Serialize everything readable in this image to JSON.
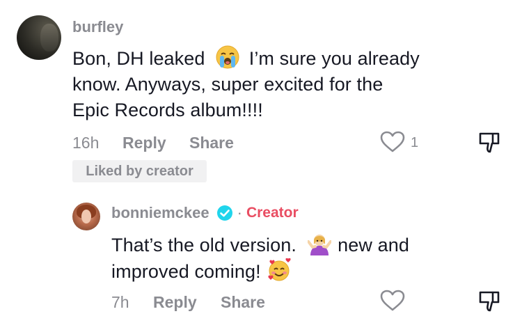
{
  "comments": [
    {
      "username": "burfley",
      "text_lines": [
        "Bon, DH leaked",
        "I’m sure you already",
        "know. Anyways, super excited for the",
        "Epic Records album!!!!"
      ],
      "emoji_1": "loudly-crying-face",
      "time": "16h",
      "reply_label": "Reply",
      "share_label": "Share",
      "like_count": "1",
      "liked_by_label": "Liked by creator"
    }
  ],
  "reply": {
    "username": "bonniemckee",
    "verified": true,
    "dot": "·",
    "creator_label": "Creator",
    "text_line_1": "That’s the old version.",
    "text_line_1b": "new and",
    "text_line_2": "improved coming!",
    "emoji_1": "woman-shrugging",
    "emoji_2": "smiling-face-with-hearts",
    "time": "7h",
    "reply_label": "Reply",
    "share_label": "Share"
  },
  "colors": {
    "creator": "#e94d62",
    "verified": "#20d5ec",
    "muted": "#8a8b91",
    "text": "#161823"
  }
}
